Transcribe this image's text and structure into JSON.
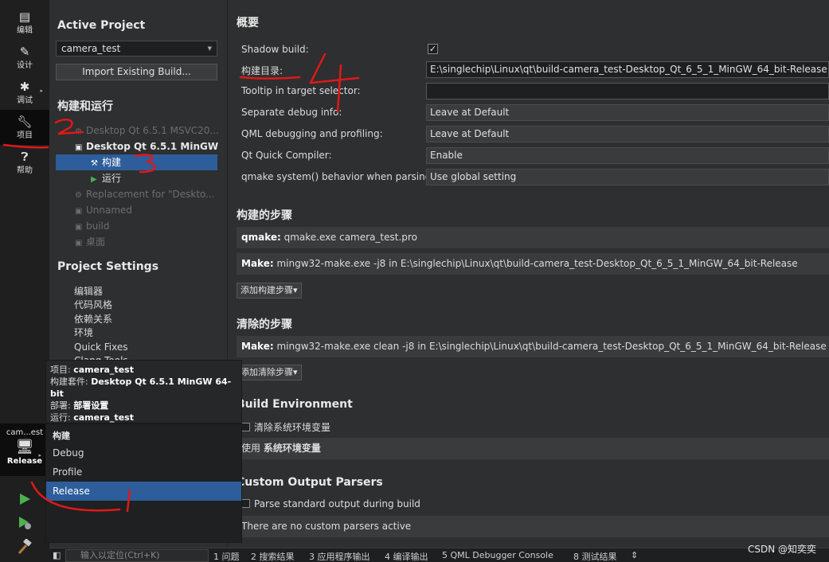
{
  "modes": [
    {
      "label": "编辑",
      "icon": "edit-icon"
    },
    {
      "label": "设计",
      "icon": "design-icon"
    },
    {
      "label": "调试",
      "icon": "debug-icon"
    },
    {
      "label": "项目",
      "icon": "project-icon"
    },
    {
      "label": "帮助",
      "icon": "help-icon"
    }
  ],
  "kit_selector": {
    "name": "cam...est",
    "build_type": "Release"
  },
  "sidebar": {
    "active_project_heading": "Active Project",
    "project_combo": "camera_test",
    "import_button": "Import Existing Build...",
    "build_run_heading": "构建和运行",
    "tree": [
      "Desktop Qt 6.5.1 MSVC20...",
      "Desktop Qt 6.5.1 MinGW ...",
      "构建",
      "运行",
      "Replacement for \"Deskto...",
      "Unnamed",
      "build",
      "桌面"
    ],
    "project_settings_heading": "Project Settings",
    "settings": [
      "编辑器",
      "代码风格",
      "依赖关系",
      "环境",
      "Quick Fixes",
      "Clang Tools"
    ]
  },
  "general": {
    "title": "概要",
    "shadow_build_label": "Shadow build:",
    "build_dir_label": "构建目录:",
    "build_dir_value": "E:\\singlechip\\Linux\\qt\\build-camera_test-Desktop_Qt_6_5_1_MinGW_64_bit-Release",
    "tooltip_label": "Tooltip in target selector:",
    "tooltip_value": "",
    "sep_debug_label": "Separate debug info:",
    "sep_debug_value": "Leave at Default",
    "qml_label": "QML debugging and profiling:",
    "qml_value": "Leave at Default",
    "qtquick_label": "Qt Quick Compiler:",
    "qtquick_value": "Enable",
    "qmake_sys_label": "qmake system() behavior when parsing:",
    "qmake_sys_value": "Use global setting"
  },
  "build_steps": {
    "title": "构建的步骤",
    "qmake_name": "qmake:",
    "qmake_cmd": "qmake.exe camera_test.pro",
    "make_name": "Make:",
    "make_cmd": "mingw32-make.exe -j8 in E:\\singlechip\\Linux\\qt\\build-camera_test-Desktop_Qt_6_5_1_MinGW_64_bit-Release",
    "add_button": "添加构建步骤"
  },
  "clean_steps": {
    "title": "清除的步骤",
    "make_name": "Make:",
    "make_cmd": "mingw32-make.exe clean -j8 in E:\\singlechip\\Linux\\qt\\build-camera_test-Desktop_Qt_6_5_1_MinGW_64_bit-Release",
    "add_button": "添加清除步骤"
  },
  "build_env": {
    "title": "Build Environment",
    "clear_env": "清除系统环境变量",
    "use_prefix": "使用",
    "use_bold": "系统环境变量"
  },
  "parsers": {
    "title": "Custom Output Parsers",
    "parse_label": "Parse standard output during build",
    "none_active": "There are no custom parsers active"
  },
  "popup": {
    "project_label": "项目:",
    "project_value": "camera_test",
    "kit_label": "构建套件:",
    "kit_value": "Desktop Qt 6.5.1 MinGW 64-bit",
    "deploy_label": "部署:",
    "deploy_value": "部署设置",
    "run_label": "运行:",
    "run_value": "camera_test",
    "build_heading": "构建",
    "build_options": [
      "Debug",
      "Profile",
      "Release"
    ],
    "selected": "Release"
  },
  "output_bar": {
    "locator_placeholder": "输入以定位(Ctrl+K)",
    "tabs": [
      "1 问题",
      "2 搜索结果",
      "3 应用程序输出",
      "4 编译输出",
      "5 QML Debugger Console",
      "8 测试结果"
    ]
  },
  "annotations": [
    "1",
    "2",
    "3",
    "4"
  ],
  "watermark": "CSDN @知奕奕"
}
